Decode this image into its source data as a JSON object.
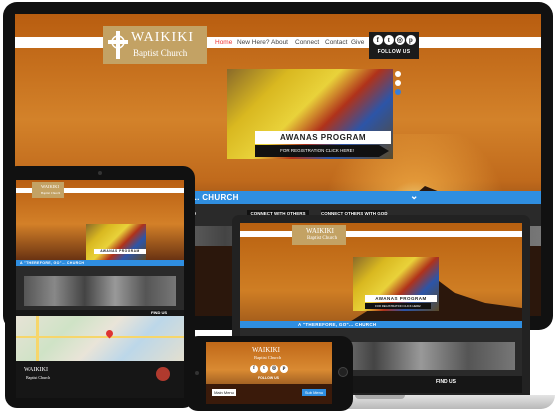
{
  "brand": {
    "name_top": "WAIKIKI",
    "name_bottom": "Baptist Church"
  },
  "nav": {
    "items": [
      "Home",
      "New Here?",
      "About",
      "Connect",
      "Contact",
      "Give"
    ],
    "active": "Home"
  },
  "social": {
    "follow_label": "FOLLOW US",
    "icons": [
      "facebook-icon",
      "twitter-icon",
      "instagram-icon",
      "pinterest-icon"
    ],
    "glyphs": [
      "f",
      "t",
      "◎",
      "p"
    ]
  },
  "hero": {
    "title": "AWANAS PROGRAM",
    "subtitle": "FOR REGISTRATION CLICK HERE!",
    "slide_count": 3,
    "active_slide": 3
  },
  "section": {
    "desktop_title": "GO\"... CHURCH",
    "tablet_title": "A \"THEREFORE, GO\"... CHURCH",
    "laptop_title": "A \"THEREFORE, GO\"... CHURCH",
    "columns": [
      "CT WITH GOD",
      "CONNECT WITH OTHERS",
      "CONNECT OTHERS WITH GOD"
    ],
    "chevron": "⌄"
  },
  "map": {
    "find_label": "FIND US"
  },
  "phone": {
    "follow_label": "FOLLOW US",
    "left_button": "Main Menu",
    "right_button": "Sub Menu"
  },
  "colors": {
    "accent_blue": "#2f8ee0",
    "nav_active": "#e33333",
    "brand_gold": "#c3a264"
  }
}
